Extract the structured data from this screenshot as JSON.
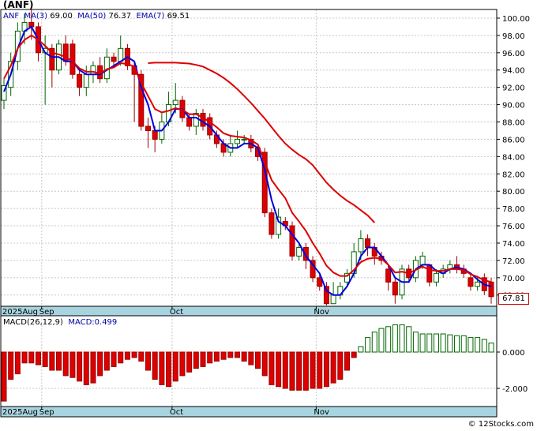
{
  "ticker_title": "(ANF)",
  "indicators": {
    "symbol": "ANF",
    "ma3": "MA(3)",
    "ma3_value": "69.00",
    "ma50": "MA(50)",
    "ma50_value": "76.37",
    "ema7": "EMA(7)",
    "ema7_value": "69.51"
  },
  "macd_header": {
    "label": "MACD(26,12,9)",
    "macd": "MACD:0.499"
  },
  "last_price": "67.81",
  "footer": "© 12Stocks.com",
  "colors": {
    "up_fill": "#ffffff",
    "up_stroke": "#006600",
    "down_fill": "#dd0000",
    "down_stroke": "#990000",
    "ma3": "#0000dd",
    "ma50": "#dd0000",
    "ema7": "#dd0000",
    "axis_band": "#a8d4e0",
    "grid": "#c8c8c8"
  },
  "chart_data": {
    "type": "candlestick",
    "price_axis": {
      "ylim": [
        66.7,
        101.0
      ],
      "ticks": [
        "100.00",
        "98.00",
        "96.00",
        "94.00",
        "92.00",
        "90.00",
        "88.00",
        "86.00",
        "84.00",
        "82.00",
        "80.00",
        "78.00",
        "76.00",
        "74.00",
        "72.00",
        "70.00",
        "68.00"
      ]
    },
    "macd_axis": {
      "ylim": [
        -3.0,
        2.0
      ],
      "ticks": [
        "0.000",
        "-2.000"
      ]
    },
    "x_labels": [
      "2025Aug",
      "Sep",
      "Oct",
      "Nov"
    ],
    "candles": [
      [
        90.5,
        92.2,
        89.5,
        93.0
      ],
      [
        92.0,
        95.0,
        91.0,
        96.0
      ],
      [
        95.0,
        98.5,
        94.0,
        99.5
      ],
      [
        98.5,
        99.5,
        97.0,
        100.5
      ],
      [
        99.5,
        99.0,
        97.5,
        101.0
      ],
      [
        99.0,
        96.0,
        95.0,
        99.5
      ],
      [
        96.0,
        96.5,
        90.0,
        98.0
      ],
      [
        96.5,
        94.0,
        92.0,
        97.0
      ],
      [
        94.0,
        97.0,
        93.5,
        97.5
      ],
      [
        97.0,
        95.0,
        94.5,
        98.0
      ],
      [
        97.0,
        93.5,
        93.0,
        97.5
      ],
      [
        93.5,
        92.0,
        91.0,
        94.0
      ],
      [
        92.0,
        93.5,
        91.0,
        94.5
      ],
      [
        93.5,
        94.5,
        92.5,
        95.0
      ],
      [
        94.5,
        93.0,
        92.5,
        95.5
      ],
      [
        93.0,
        95.5,
        92.5,
        96.5
      ],
      [
        95.5,
        95.0,
        94.5,
        96.0
      ],
      [
        95.0,
        96.5,
        94.5,
        98.0
      ],
      [
        96.5,
        94.5,
        94.0,
        97.0
      ],
      [
        94.5,
        93.5,
        88.0,
        95.0
      ],
      [
        93.5,
        87.5,
        87.0,
        94.0
      ],
      [
        87.5,
        87.0,
        85.0,
        88.5
      ],
      [
        87.0,
        86.0,
        84.5,
        87.5
      ],
      [
        86.0,
        88.0,
        85.5,
        89.0
      ],
      [
        88.0,
        90.0,
        87.5,
        91.5
      ],
      [
        90.0,
        90.5,
        89.0,
        92.5
      ],
      [
        90.5,
        88.5,
        88.0,
        91.0
      ],
      [
        88.5,
        87.5,
        87.0,
        89.0
      ],
      [
        87.5,
        89.0,
        86.5,
        89.5
      ],
      [
        89.0,
        87.5,
        87.0,
        89.5
      ],
      [
        88.5,
        86.5,
        86.0,
        89.0
      ],
      [
        86.5,
        85.5,
        85.0,
        87.0
      ],
      [
        85.5,
        84.5,
        84.0,
        86.0
      ],
      [
        84.5,
        85.5,
        84.0,
        86.5
      ],
      [
        85.5,
        86.0,
        85.0,
        87.0
      ],
      [
        86.0,
        86.0,
        85.5,
        86.5
      ],
      [
        86.0,
        85.0,
        84.5,
        86.5
      ],
      [
        85.0,
        84.0,
        83.5,
        85.5
      ],
      [
        84.5,
        77.5,
        77.0,
        85.0
      ],
      [
        77.5,
        75.0,
        74.5,
        78.0
      ],
      [
        75.0,
        77.0,
        74.5,
        78.0
      ],
      [
        76.5,
        76.0,
        75.5,
        77.0
      ],
      [
        76.0,
        72.5,
        72.0,
        76.5
      ],
      [
        72.5,
        73.5,
        72.0,
        74.0
      ],
      [
        73.5,
        72.0,
        71.0,
        74.0
      ],
      [
        72.0,
        70.0,
        69.5,
        72.5
      ],
      [
        70.0,
        69.0,
        68.5,
        70.5
      ],
      [
        69.0,
        67.0,
        66.8,
        69.5
      ],
      [
        67.0,
        68.0,
        67.0,
        69.5
      ],
      [
        68.0,
        69.0,
        67.5,
        69.5
      ],
      [
        69.5,
        70.5,
        69.0,
        71.0
      ],
      [
        70.5,
        73.0,
        70.0,
        74.0
      ],
      [
        73.0,
        74.5,
        72.0,
        75.5
      ],
      [
        74.5,
        73.5,
        72.5,
        75.0
      ],
      [
        73.5,
        72.5,
        71.5,
        74.0
      ],
      [
        72.5,
        72.0,
        71.5,
        73.0
      ],
      [
        71.0,
        69.5,
        68.5,
        71.5
      ],
      [
        69.5,
        68.0,
        67.0,
        70.0
      ],
      [
        68.0,
        71.0,
        67.5,
        71.5
      ],
      [
        71.0,
        70.0,
        69.5,
        71.5
      ],
      [
        70.0,
        72.0,
        69.5,
        72.5
      ],
      [
        71.5,
        72.5,
        71.0,
        73.0
      ],
      [
        71.5,
        69.5,
        69.0,
        71.5
      ],
      [
        69.5,
        70.5,
        69.0,
        71.0
      ],
      [
        70.5,
        71.0,
        70.0,
        71.5
      ],
      [
        71.0,
        71.5,
        70.5,
        72.0
      ],
      [
        71.5,
        71.0,
        70.5,
        72.5
      ],
      [
        71.0,
        70.5,
        70.0,
        71.5
      ],
      [
        70.0,
        69.0,
        68.5,
        70.5
      ],
      [
        69.0,
        69.5,
        68.5,
        70.0
      ],
      [
        70.0,
        68.5,
        68.0,
        70.5
      ],
      [
        69.5,
        67.81,
        67.0,
        70.0
      ]
    ],
    "series": [
      {
        "name": "MA(3)",
        "color": "#0000dd",
        "values": [
          91.5,
          93.5,
          96.5,
          98.5,
          99.0,
          97.5,
          96.0,
          95.5,
          95.5,
          95.0,
          95.0,
          94.0,
          93.5,
          93.5,
          93.5,
          94.0,
          94.5,
          95.0,
          95.5,
          95.0,
          92.0,
          90.0,
          87.0,
          87.0,
          88.0,
          89.5,
          89.5,
          88.5,
          88.5,
          88.0,
          87.5,
          86.5,
          85.5,
          85.0,
          85.0,
          85.5,
          85.5,
          85.0,
          82.5,
          79.0,
          76.5,
          76.0,
          75.0,
          74.0,
          72.5,
          71.5,
          70.5,
          68.5,
          68.0,
          68.0,
          69.0,
          70.5,
          72.5,
          73.5,
          73.5,
          72.5,
          71.5,
          70.0,
          69.5,
          69.5,
          71.0,
          71.5,
          71.5,
          70.8,
          70.5,
          71.0,
          71.2,
          71.0,
          70.5,
          69.8,
          69.2,
          69.0
        ]
      },
      {
        "name": "EMA(7)",
        "color": "#dd0000",
        "values": [
          93.0,
          94.5,
          96.5,
          97.5,
          98.0,
          97.5,
          96.8,
          96.0,
          95.8,
          95.5,
          95.0,
          94.2,
          93.8,
          93.8,
          93.6,
          94.1,
          94.3,
          94.8,
          94.7,
          94.4,
          92.5,
          91.0,
          89.5,
          89.1,
          89.3,
          89.6,
          89.4,
          88.9,
          88.9,
          88.5,
          88.0,
          87.4,
          86.7,
          86.4,
          86.3,
          86.2,
          85.9,
          85.4,
          83.4,
          81.3,
          80.2,
          79.2,
          77.5,
          76.5,
          75.4,
          74.0,
          72.8,
          71.4,
          70.6,
          70.2,
          70.2,
          70.9,
          71.8,
          72.2,
          72.3,
          72.2,
          71.5,
          70.6,
          70.7,
          70.5,
          70.9,
          71.3,
          70.9,
          70.8,
          70.8,
          71.0,
          71.0,
          70.9,
          70.4,
          70.1,
          69.7,
          69.51
        ]
      },
      {
        "name": "MA(50)",
        "color": "#dd0000",
        "start": 21,
        "values": [
          94.8,
          94.85,
          94.85,
          94.85,
          94.85,
          94.8,
          94.75,
          94.6,
          94.4,
          94.0,
          93.6,
          93.1,
          92.5,
          91.8,
          91.0,
          90.2,
          89.3,
          88.4,
          87.4,
          86.4,
          85.5,
          84.8,
          84.2,
          83.7,
          83.0,
          82.0,
          81.0,
          80.2,
          79.5,
          78.9,
          78.4,
          77.8,
          77.2,
          76.37
        ]
      }
    ],
    "ma50_x_positions_note": "",
    "macd_histogram": [
      -2.7,
      -1.5,
      -1.2,
      -0.6,
      -0.6,
      -0.7,
      -0.8,
      -1.0,
      -1.0,
      -1.3,
      -1.4,
      -1.6,
      -1.8,
      -1.7,
      -1.3,
      -1.0,
      -0.8,
      -0.6,
      -0.4,
      -0.3,
      -0.5,
      -1.0,
      -1.5,
      -1.8,
      -1.9,
      -1.6,
      -1.3,
      -1.1,
      -0.9,
      -0.8,
      -0.6,
      -0.5,
      -0.4,
      -0.3,
      -0.3,
      -0.5,
      -0.7,
      -0.9,
      -1.3,
      -1.8,
      -1.9,
      -2.0,
      -2.1,
      -2.1,
      -2.1,
      -2.0,
      -2.0,
      -1.9,
      -1.7,
      -1.5,
      -1.0,
      -0.3,
      0.3,
      0.8,
      1.1,
      1.3,
      1.4,
      1.5,
      1.5,
      1.4,
      1.1,
      1.0,
      1.0,
      1.0,
      1.0,
      0.95,
      0.9,
      0.9,
      0.8,
      0.8,
      0.7,
      0.499
    ]
  }
}
